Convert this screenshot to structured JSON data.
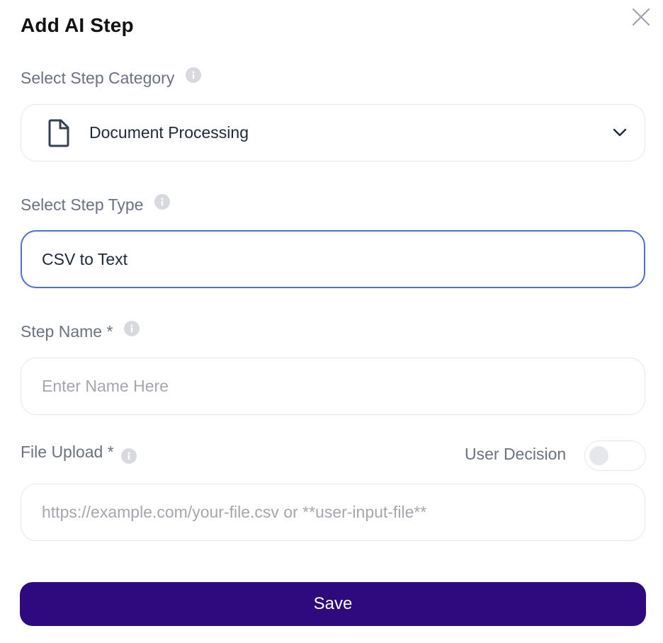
{
  "dialog": {
    "title": "Add AI Step",
    "close_icon": "close-icon"
  },
  "category": {
    "label": "Select Step Category",
    "value": "Document Processing",
    "icon": "document-icon"
  },
  "step_type": {
    "label": "Select Step Type",
    "value": "CSV to Text"
  },
  "step_name": {
    "label": "Step Name *",
    "placeholder": "Enter Name Here",
    "value": ""
  },
  "file_upload": {
    "label": "File Upload *",
    "placeholder": "https://example.com/your-file.csv or **user-input-file**",
    "value": ""
  },
  "user_decision": {
    "label": "User Decision",
    "enabled": false
  },
  "save": {
    "label": "Save"
  },
  "colors": {
    "primary": "#2e0a7e",
    "focus_border": "#4f6ed8"
  }
}
